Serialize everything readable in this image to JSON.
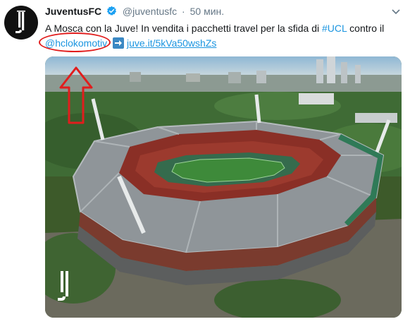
{
  "tweet": {
    "display_name": "JuventusFC",
    "handle": "@juventusfc",
    "separator": "·",
    "time": "50 мин.",
    "text_part1": "A Mosca con la Juve! In vendita i pacchetti travel per la sfida di ",
    "hashtag": "#UCL",
    "text_part2": " contro il",
    "mention": "@hclokomotiv",
    "url": "juve.it/5kVa50wshZs"
  },
  "photo": {
    "watermark": "JUVENTUS"
  },
  "annotations": {
    "highlight_color": "#e11d1d"
  },
  "icons": [
    "juventus-logo-icon",
    "verified-badge-icon",
    "chevron-down-icon",
    "right-arrow-emoji-icon",
    "red-arrow-icon"
  ]
}
